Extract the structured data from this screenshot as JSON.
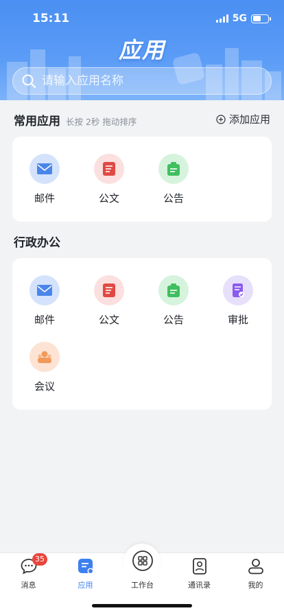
{
  "status_bar": {
    "time": "15:11",
    "network": "5G"
  },
  "header": {
    "title": "应用"
  },
  "search": {
    "placeholder": "请输入应用名称"
  },
  "common_section": {
    "title": "常用应用",
    "hint": "长按 2秒 拖动排序",
    "add_label": "添加应用",
    "apps": [
      {
        "label": "邮件",
        "icon": "mail-icon"
      },
      {
        "label": "公文",
        "icon": "document-icon"
      },
      {
        "label": "公告",
        "icon": "notice-icon"
      }
    ]
  },
  "admin_section": {
    "title": "行政办公",
    "apps": [
      {
        "label": "邮件",
        "icon": "mail-icon"
      },
      {
        "label": "公文",
        "icon": "document-icon"
      },
      {
        "label": "公告",
        "icon": "notice-icon"
      },
      {
        "label": "审批",
        "icon": "approval-icon"
      },
      {
        "label": "会议",
        "icon": "meeting-icon"
      }
    ]
  },
  "tabbar": {
    "items": [
      {
        "label": "消息",
        "icon": "message-icon",
        "badge": "35"
      },
      {
        "label": "应用",
        "icon": "app-icon",
        "active": true
      },
      {
        "label": "工作台",
        "icon": "workbench-icon"
      },
      {
        "label": "通讯录",
        "icon": "contacts-icon"
      },
      {
        "label": "我的",
        "icon": "profile-icon"
      }
    ]
  },
  "colors": {
    "header": "#4a8ff2",
    "accent": "#3d7ff0",
    "mail_bg": "#d4e3fb",
    "doc_bg": "#fbe0df",
    "notice_bg": "#d6f3dd",
    "approval_bg": "#e7e0fb",
    "meeting_bg": "#fde3d3"
  }
}
